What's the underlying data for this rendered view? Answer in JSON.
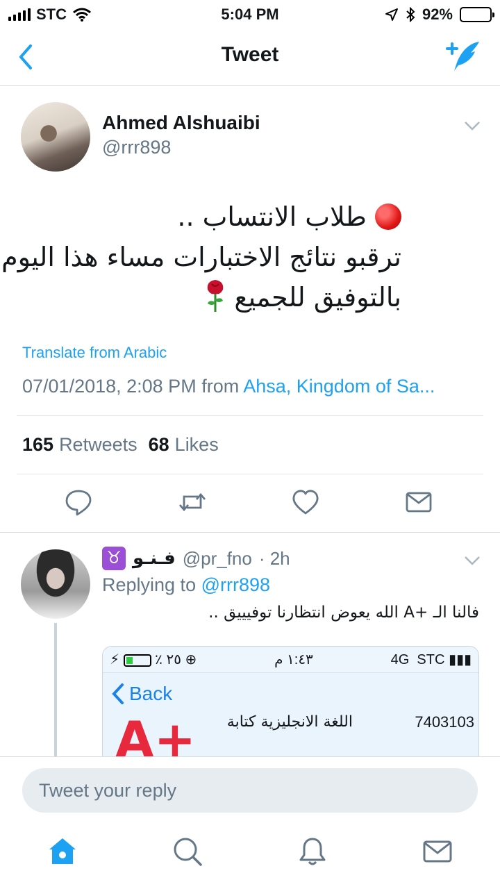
{
  "status_bar": {
    "carrier": "STC",
    "time": "5:04 PM",
    "battery": "92%",
    "battery_level": 0.92
  },
  "nav": {
    "title": "Tweet"
  },
  "tweet": {
    "author_name": "Ahmed Alshuaibi",
    "author_handle": "@rrr898",
    "text_line1": "طلاب الانتساب ..",
    "text_line2": "ترقبو نتائج الاختبارات مساء هذا اليوم",
    "text_line3": "بالتوفيق للجميع",
    "translate_label": "Translate from Arabic",
    "timestamp": "07/01/2018, 2:08 PM",
    "from_label": "from",
    "place": "Ahsa, Kingdom of Sa...",
    "retweets_count": "165",
    "retweets_label": "Retweets",
    "likes_count": "68",
    "likes_label": "Likes"
  },
  "reply": {
    "zodiac": "♉",
    "name": "فـنـو",
    "handle": "@pr_fno",
    "time": "· 2h",
    "replying_prefix": "Replying to",
    "replying_to": "@rrr898",
    "text": "فالنا الـ +A  الله يعوض انتظارنا توفيييق ..",
    "embed": {
      "carrier": "STC",
      "network": "4G",
      "time": "١:٤٣ م",
      "battery": "٪ ٢٥",
      "back_label": "Back",
      "course_code": "7403103",
      "course_name": "اللغة الانجليزية كتابة",
      "grade": "A+"
    }
  },
  "compose": {
    "placeholder": "Tweet your reply"
  },
  "colors": {
    "accent": "#1da1f2",
    "secondary_text": "#657786",
    "divider": "#e1e8ed"
  },
  "icons": {
    "nav": [
      "back-chevron-icon",
      "compose-tweet-icon"
    ],
    "actions": [
      "reply-icon",
      "retweet-icon",
      "like-icon",
      "direct-message-icon"
    ],
    "tabs": [
      "home-icon",
      "search-icon",
      "notifications-icon",
      "messages-icon"
    ]
  }
}
